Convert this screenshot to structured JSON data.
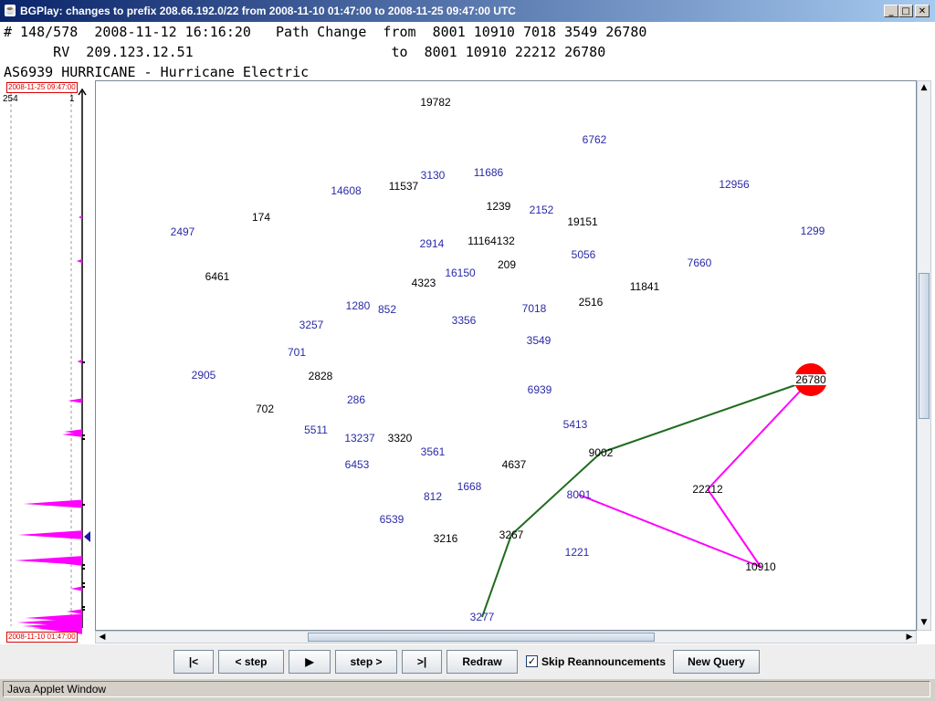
{
  "window": {
    "title": "BGPlay: changes to prefix 208.66.192.0/22 from 2008-11-10 01:47:00 to 2008-11-25 09:47:00 UTC",
    "minimize_icon": "minimize-icon",
    "maximize_icon": "maximize-icon",
    "close_icon": "close-icon"
  },
  "header": {
    "line1": "# 148/578  2008-11-12 16:16:20   Path Change  from  8001 10910 7018 3549 26780",
    "line2": "      RV  209.123.12.51                        to  8001 10910 22212 26780",
    "line3": "AS6939 HURRICANE - Hurricane Electric"
  },
  "timeline": {
    "top_timestamp": "2008-11-25 09:47:00",
    "bottom_timestamp": "2008-11-10 01:47:00",
    "top_left_number": "254",
    "top_right_number": "1",
    "spike_color": "#ff00ff",
    "marker_color": "#1a1aa6",
    "spike_levels": [
      0.05,
      0.08,
      0.07,
      0.2,
      0.25,
      0.28,
      0.82,
      0.9,
      0.95,
      0.3,
      0.16,
      0.22,
      0.8,
      0.92,
      0.84,
      0.7,
      0.62,
      0.5,
      0.4,
      0.26,
      0.18,
      0.14,
      0.16,
      0.4,
      0.3
    ]
  },
  "graph": {
    "colors": {
      "blue": "#2a2aa8",
      "black": "#000000",
      "magenta": "#ff00ff",
      "green": "#1f6b1f",
      "origin": "#ff0000"
    },
    "nodes": [
      {
        "label": "19782",
        "color": "black"
      },
      {
        "label": "6762",
        "color": "blue"
      },
      {
        "label": "3130",
        "color": "blue"
      },
      {
        "label": "11686",
        "color": "blue"
      },
      {
        "label": "14608",
        "color": "blue"
      },
      {
        "label": "11537",
        "color": "black"
      },
      {
        "label": "12956",
        "color": "blue"
      },
      {
        "label": "1239",
        "color": "black"
      },
      {
        "label": "2152",
        "color": "blue"
      },
      {
        "label": "19151",
        "color": "black"
      },
      {
        "label": "174",
        "color": "black"
      },
      {
        "label": "2497",
        "color": "blue"
      },
      {
        "label": "1299",
        "color": "blue"
      },
      {
        "label": "2914",
        "color": "blue"
      },
      {
        "label": "11164132",
        "color": "black"
      },
      {
        "label": "5056",
        "color": "blue"
      },
      {
        "label": "7660",
        "color": "blue"
      },
      {
        "label": "209",
        "color": "black"
      },
      {
        "label": "6461",
        "color": "black"
      },
      {
        "label": "16150",
        "color": "blue"
      },
      {
        "label": "4323",
        "color": "black"
      },
      {
        "label": "11841",
        "color": "black"
      },
      {
        "label": "2516",
        "color": "black"
      },
      {
        "label": "1280",
        "color": "blue"
      },
      {
        "label": "852",
        "color": "blue"
      },
      {
        "label": "7018",
        "color": "blue"
      },
      {
        "label": "3257",
        "color": "blue"
      },
      {
        "label": "3356",
        "color": "blue"
      },
      {
        "label": "701",
        "color": "blue"
      },
      {
        "label": "3549",
        "color": "blue"
      },
      {
        "label": "2905",
        "color": "blue"
      },
      {
        "label": "2828",
        "color": "black"
      },
      {
        "label": "6939",
        "color": "blue"
      },
      {
        "label": "286",
        "color": "blue"
      },
      {
        "label": "702",
        "color": "black"
      },
      {
        "label": "5413",
        "color": "blue"
      },
      {
        "label": "5511",
        "color": "blue"
      },
      {
        "label": "13237",
        "color": "blue"
      },
      {
        "label": "3320",
        "color": "black"
      },
      {
        "label": "3561",
        "color": "blue"
      },
      {
        "label": "9002",
        "color": "black"
      },
      {
        "label": "6453",
        "color": "blue"
      },
      {
        "label": "4637",
        "color": "black"
      },
      {
        "label": "1668",
        "color": "blue"
      },
      {
        "label": "22212",
        "color": "black"
      },
      {
        "label": "812",
        "color": "blue"
      },
      {
        "label": "8001",
        "color": "blue"
      },
      {
        "label": "6539",
        "color": "blue"
      },
      {
        "label": "3267",
        "color": "black"
      },
      {
        "label": "3216",
        "color": "black"
      },
      {
        "label": "1221",
        "color": "blue"
      },
      {
        "label": "10910",
        "color": "black"
      },
      {
        "label": "3277",
        "color": "blue"
      },
      {
        "label": "26780",
        "color": "black",
        "origin": true
      }
    ],
    "edges": [
      {
        "from": "26780",
        "to": "9002",
        "color": "green"
      },
      {
        "from": "9002",
        "to": "3267",
        "color": "green"
      },
      {
        "from": "3267",
        "to": "3277",
        "color": "green"
      },
      {
        "from": "26780",
        "to": "22212",
        "color": "magenta"
      },
      {
        "from": "22212",
        "to": "10910",
        "color": "magenta"
      },
      {
        "from": "8001",
        "to": "10910",
        "color": "magenta"
      }
    ]
  },
  "scrollbars": {
    "up_arrow_icon": "up-arrow-icon",
    "down_arrow_icon": "down-arrow-icon",
    "left_arrow_icon": "left-arrow-icon",
    "right_arrow_icon": "right-arrow-icon"
  },
  "toolbar": {
    "first_label": "|<",
    "prev_step_label": "< step",
    "play_label": "▶",
    "next_step_label": "step >",
    "last_label": ">|",
    "redraw_label": "Redraw",
    "skip_label": "Skip Reannouncements",
    "skip_checked": true,
    "new_query_label": "New Query"
  },
  "status": {
    "text": "Java Applet Window"
  }
}
